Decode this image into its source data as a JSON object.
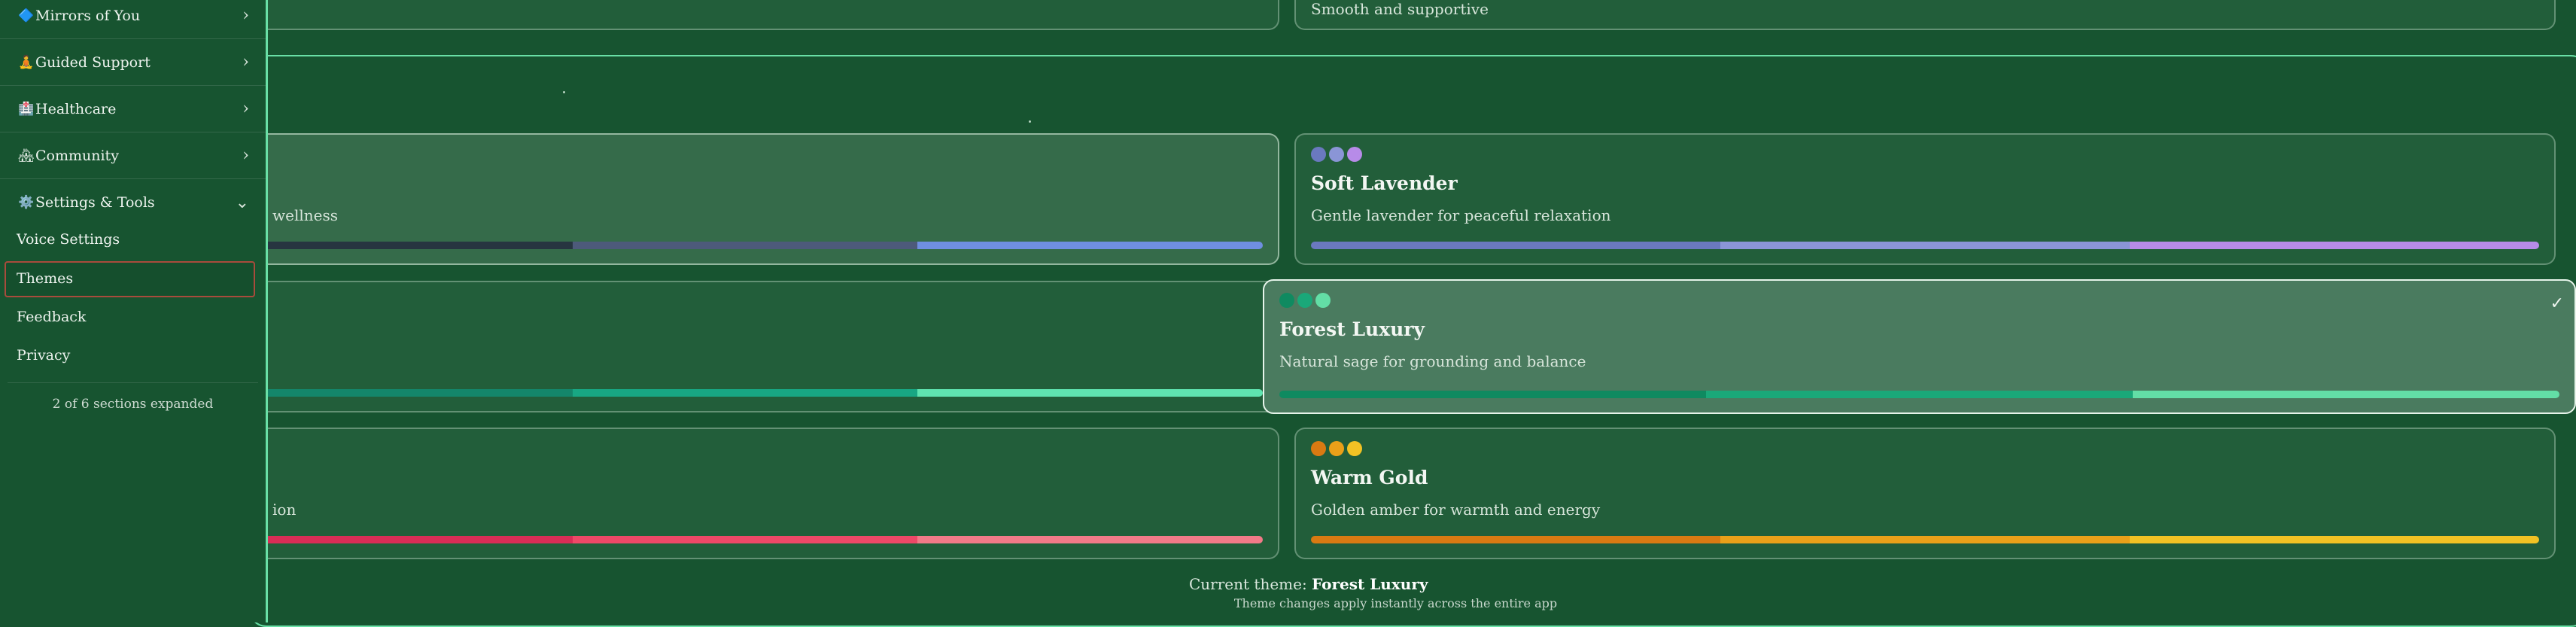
{
  "sidebar": {
    "sections": [
      {
        "icon": "diamond-icon",
        "emoji": "🔷",
        "label": "Mirrors of You",
        "chevron": "›"
      },
      {
        "icon": "meditation-icon",
        "emoji": "🧘",
        "label": "Guided Support",
        "chevron": "›"
      },
      {
        "icon": "hospital-icon",
        "emoji": "🏥",
        "label": "Healthcare",
        "chevron": "›"
      },
      {
        "icon": "community-icon",
        "emoji": "🏘",
        "label": "Community",
        "chevron": "›"
      },
      {
        "icon": "gear-icon",
        "emoji": "⚙️",
        "label": "Settings & Tools",
        "chevron": "⌄"
      }
    ],
    "sub_items": [
      "Voice Settings",
      "Themes",
      "Feedback",
      "Privacy"
    ],
    "status": "2 of 6 sections expanded"
  },
  "top_partial": {
    "desc": "Smooth and supportive"
  },
  "themes": [
    {
      "title": "",
      "desc": "wellness",
      "colors": [
        "#273540",
        "#4d5a7a",
        "#6f8fe0"
      ]
    },
    {
      "title": "Soft Lavender",
      "desc": "Gentle lavender for peaceful relaxation",
      "colors": [
        "#6a79bf",
        "#8a95d6",
        "#b78be8"
      ]
    },
    {
      "title": "",
      "desc": "",
      "colors": [
        "#14866a",
        "#18a783",
        "#5fe4b0"
      ]
    },
    {
      "title": "Forest Luxury",
      "desc": "Natural sage for grounding and balance",
      "colors": [
        "#0f8a60",
        "#1aa879",
        "#63dea6"
      ],
      "selected_mark": "✓"
    },
    {
      "title": "",
      "desc": "ion",
      "colors": [
        "#d92d56",
        "#ee4867",
        "#f27a88"
      ]
    },
    {
      "title": "Warm Gold",
      "desc": "Golden amber for warmth and energy",
      "colors": [
        "#d97a12",
        "#eaa019",
        "#f2c224"
      ]
    }
  ],
  "footer": {
    "current_label": "Current theme:",
    "current_value": "Forest Luxury",
    "note": "Theme changes apply instantly across the entire app"
  }
}
